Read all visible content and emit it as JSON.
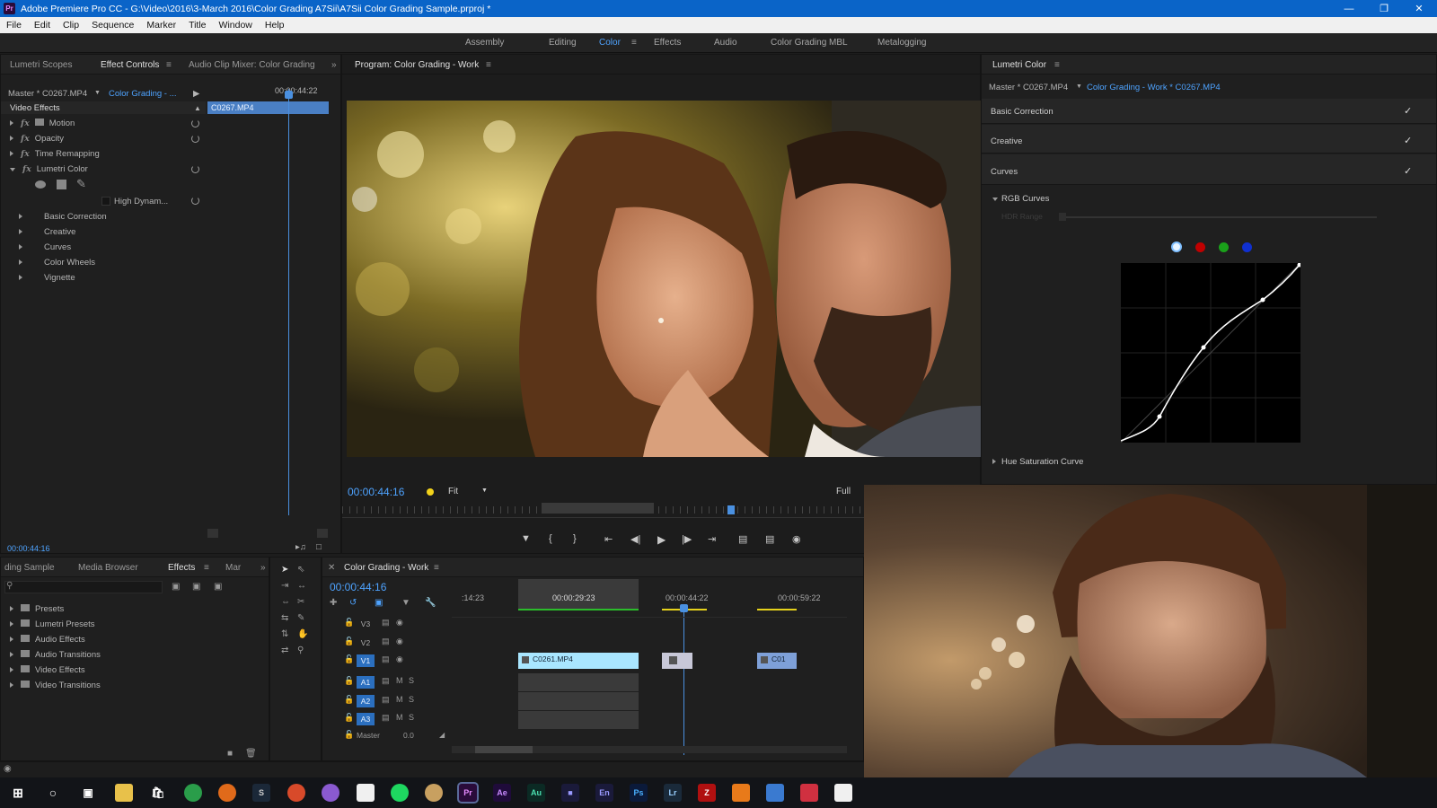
{
  "window": {
    "title": "Adobe Premiere Pro CC - G:\\Video\\2016\\3-March 2016\\Color Grading A7Sii\\A7Sii Color Grading Sample.prproj *",
    "app_badge": "Pr"
  },
  "menu": [
    "File",
    "Edit",
    "Clip",
    "Sequence",
    "Marker",
    "Title",
    "Window",
    "Help"
  ],
  "workspaces": [
    "Assembly",
    "Editing",
    "Color",
    "Effects",
    "Audio",
    "Color Grading MBL",
    "Metalogging"
  ],
  "active_workspace": "Color",
  "left_panel": {
    "tabs": [
      "Lumetri Scopes",
      "Effect Controls",
      "Audio Clip Mixer: Color Grading"
    ],
    "source_label": "Master * C0267.MP4",
    "sequence_label": "Color Grading - ...",
    "timecode_top": "00:00:44:22",
    "clip_name": "C0267.MP4",
    "section": "Video Effects",
    "effects": [
      "Motion",
      "Opacity",
      "Time Remapping",
      "Lumetri Color"
    ],
    "high_dynamic": "High Dynam...",
    "lumetri_sections": [
      "Basic Correction",
      "Creative",
      "Curves",
      "Color Wheels",
      "Vignette"
    ],
    "timecode_bottom": "00:00:44:16"
  },
  "program_monitor": {
    "title": "Program: Color Grading - Work",
    "timecode": "00:00:44:16",
    "fit": "Fit",
    "quality": "Full"
  },
  "lumetri_panel": {
    "title": "Lumetri Color",
    "source": "Master * C0267.MP4",
    "sequence": "Color Grading - Work * C0267.MP4",
    "sections": [
      "Basic Correction",
      "Creative",
      "Curves"
    ],
    "subsection": "RGB Curves",
    "hdr_range": "HDR Range",
    "hue_sat": "Hue Saturation Curve",
    "channel_colors": [
      "#e8f4ff",
      "#c00000",
      "#1aa01a",
      "#1030d0"
    ]
  },
  "effects_panel": {
    "tabs": [
      "ding Sample",
      "Media Browser",
      "Effects",
      "Mar"
    ],
    "items": [
      "Presets",
      "Lumetri Presets",
      "Audio Effects",
      "Audio Transitions",
      "Video Effects",
      "Video Transitions"
    ]
  },
  "timeline": {
    "title": "Color Grading - Work",
    "timecode": "00:00:44:16",
    "ruler": [
      ":14:23",
      "00:00:29:23",
      "00:00:44:22",
      "00:00:59:22"
    ],
    "video_tracks": [
      "V3",
      "V2",
      "V1"
    ],
    "audio_tracks": [
      "A1",
      "A2",
      "A3"
    ],
    "track_m": "M",
    "track_s": "S",
    "master": "Master",
    "master_value": "0.0",
    "clips": [
      "C0261.MP4",
      "C01"
    ]
  },
  "taskbar_icons": [
    "Pr",
    "Ae",
    "Au",
    "En",
    "Ps",
    "Lr"
  ]
}
